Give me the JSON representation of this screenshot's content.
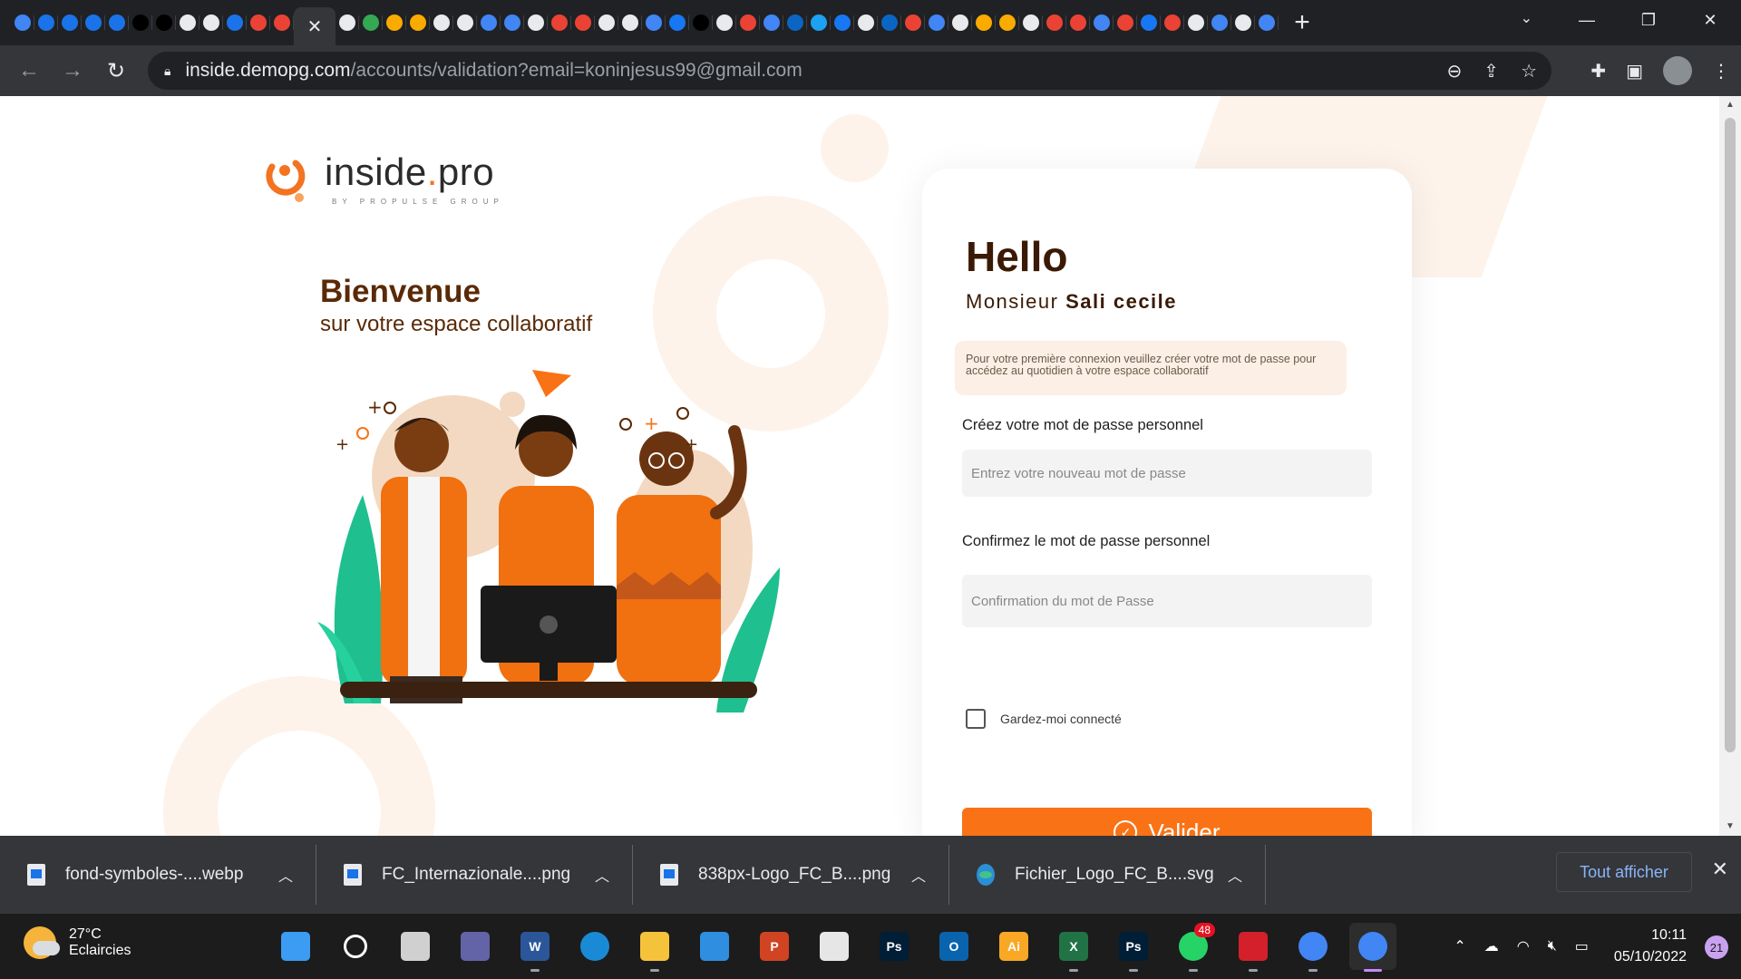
{
  "browser": {
    "active_tab_close": "✕",
    "new_tab": "+",
    "url_host": "inside.demopg.com",
    "url_path": "/accounts/validation?email=koninjesus99@gmail.com"
  },
  "page": {
    "logo_name": "inside",
    "logo_dot": ".",
    "logo_suffix": "pro",
    "logo_tagline": "BY PROPULSE GROUP",
    "welcome_title": "Bienvenue",
    "welcome_subtitle": "sur votre espace collaboratif",
    "card": {
      "hello": "Hello",
      "salutation": "Monsieur",
      "user_name": "Sali cecile",
      "notice": "Pour votre première connexion veuillez créer votre mot de passe pour accédez au quotidien à votre espace collaboratif",
      "password_label": "Créez votre mot de passe personnel",
      "password_placeholder": "Entrez votre nouveau mot de passe",
      "confirm_label": "Confirmez le mot de passe personnel",
      "confirm_placeholder": "Confirmation du mot de Passe",
      "remember_label": "Gardez-moi connecté",
      "remember_checked": false,
      "submit_label": "Valider"
    },
    "colors": {
      "accent": "#f97316",
      "dark_brown": "#3a1a04",
      "notice_bg": "#fcefe5"
    }
  },
  "downloads": {
    "items": [
      {
        "name": "fond-symboles-....webp",
        "icon": "image-file-icon"
      },
      {
        "name": "FC_Internazionale....png",
        "icon": "image-file-icon"
      },
      {
        "name": "838px-Logo_FC_B....png",
        "icon": "image-file-icon"
      },
      {
        "name": "Fichier_Logo_FC_B....svg",
        "icon": "edge-file-icon"
      }
    ],
    "show_all": "Tout afficher"
  },
  "taskbar": {
    "weather_temp": "27°C",
    "weather_desc": "Eclaircies",
    "apps": [
      {
        "name": "start",
        "label": "",
        "color": "#3b9cf2"
      },
      {
        "name": "search",
        "label": "",
        "color": "#1c1c1c"
      },
      {
        "name": "task-view",
        "label": "",
        "color": "#d0d0d0"
      },
      {
        "name": "teams",
        "label": "",
        "color": "#6264a7"
      },
      {
        "name": "word",
        "label": "W",
        "color": "#2b579a"
      },
      {
        "name": "edge",
        "label": "",
        "color": "#1b8ad6"
      },
      {
        "name": "explorer",
        "label": "",
        "color": "#f5c33b"
      },
      {
        "name": "mail",
        "label": "",
        "color": "#2f8ee0"
      },
      {
        "name": "powerpoint",
        "label": "P",
        "color": "#d04423"
      },
      {
        "name": "store",
        "label": "",
        "color": "#e6e6e6"
      },
      {
        "name": "photoshop-1",
        "label": "Ps",
        "color": "#001e36"
      },
      {
        "name": "outlook",
        "label": "O",
        "color": "#0a64ad"
      },
      {
        "name": "illustrator",
        "label": "Ai",
        "color": "#f9a825"
      },
      {
        "name": "excel",
        "label": "X",
        "color": "#217346"
      },
      {
        "name": "photoshop-2",
        "label": "Ps",
        "color": "#001e36"
      },
      {
        "name": "whatsapp",
        "label": "",
        "color": "#25d366",
        "badge": "48"
      },
      {
        "name": "acrobat",
        "label": "",
        "color": "#d4202a"
      },
      {
        "name": "chrome-1",
        "label": "",
        "color": "#4285f4"
      },
      {
        "name": "chrome-2",
        "label": "",
        "color": "#4285f4"
      }
    ],
    "time": "10:11",
    "date": "05/10/2022",
    "notifications": "21"
  }
}
